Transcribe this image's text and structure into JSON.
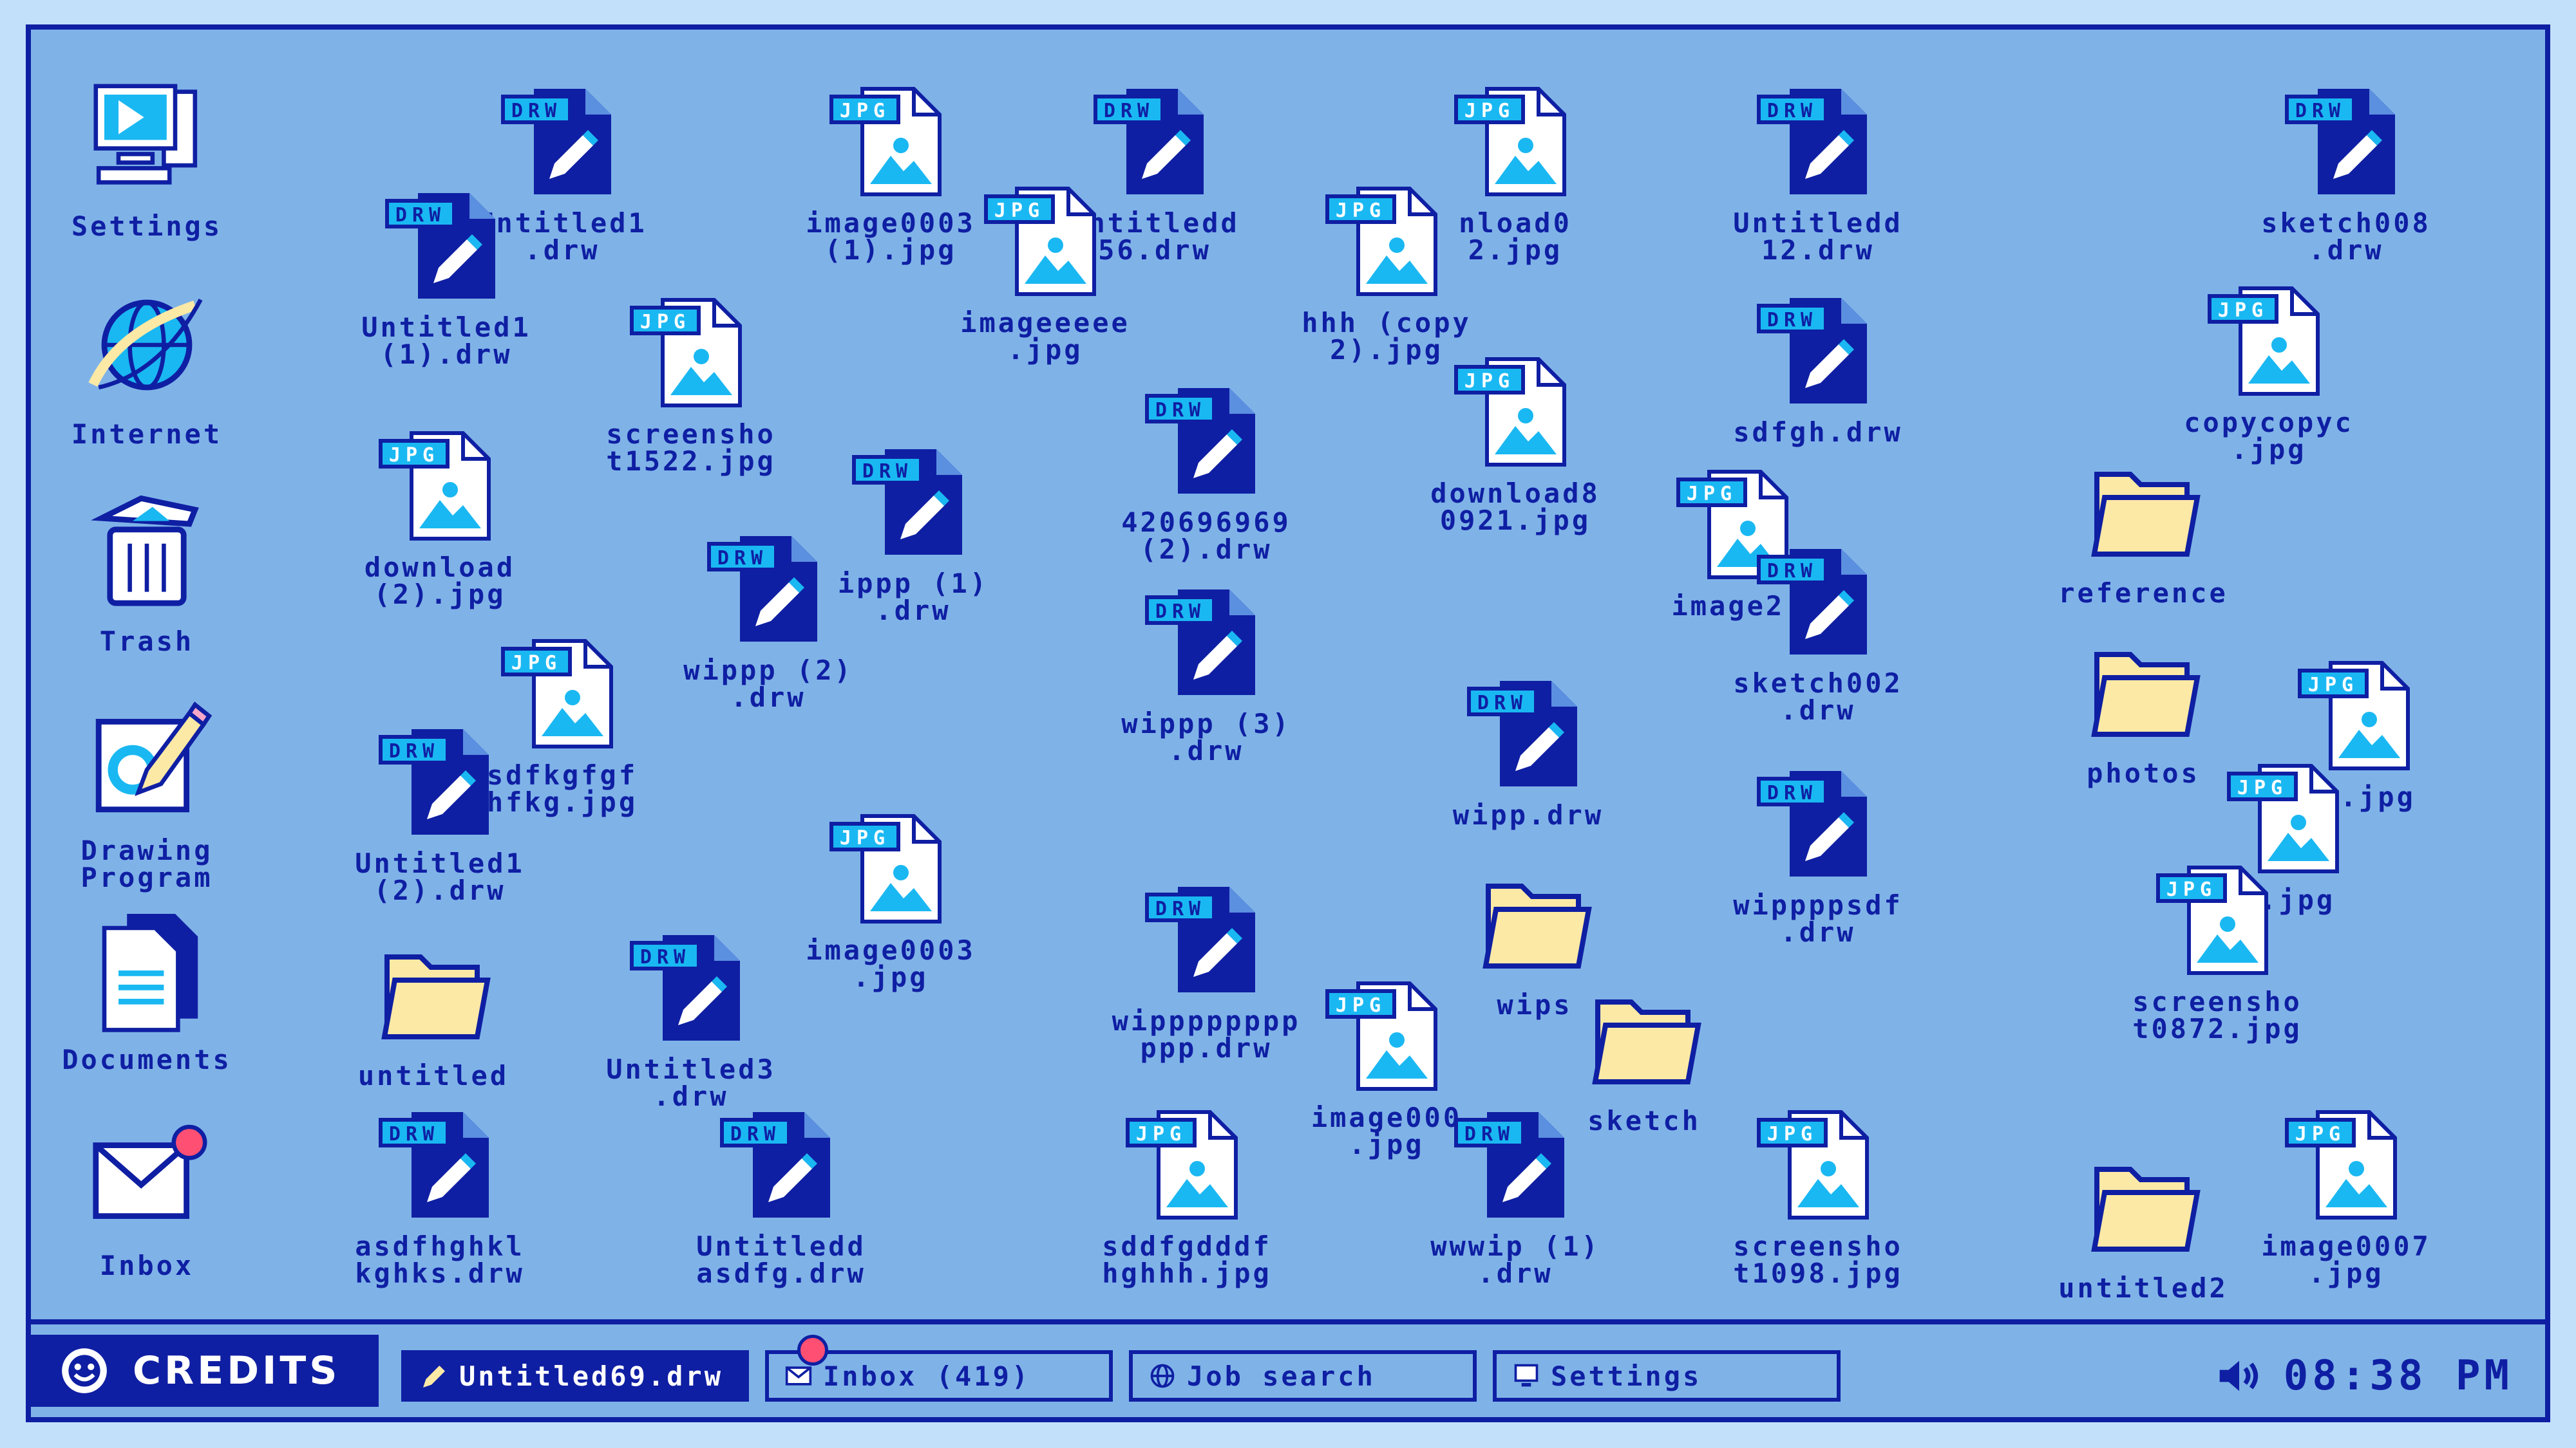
{
  "desktop": {
    "system_icons": [
      {
        "label": "Settings",
        "icon": "settings-computer-icon"
      },
      {
        "label": "Internet",
        "icon": "globe-icon"
      },
      {
        "label": "Trash",
        "icon": "trash-icon"
      },
      {
        "label": "Drawing\nProgram",
        "icon": "drawing-program-icon"
      },
      {
        "label": "Documents",
        "icon": "documents-icon"
      },
      {
        "label": "Inbox",
        "icon": "mail-icon"
      }
    ],
    "files": [
      {
        "label": "Untitled1\n.drw",
        "type": "DRW"
      },
      {
        "label": "Untitled1\n(1).drw",
        "type": "DRW"
      },
      {
        "label": "image0003\n(1).jpg",
        "type": "JPG"
      },
      {
        "label": "Untitledd\n56.drw",
        "type": "DRW"
      },
      {
        "label": "imageeeee\n.jpg",
        "type": "JPG"
      },
      {
        "label": "nload0\n2.jpg",
        "type": "JPG"
      },
      {
        "label": "hhh (copy\n2).jpg",
        "type": "JPG"
      },
      {
        "label": "Untitledd\n12.drw",
        "type": "DRW"
      },
      {
        "label": "sketch008\n.drw",
        "type": "DRW"
      },
      {
        "label": "screensho\nt1522.jpg",
        "type": "JPG"
      },
      {
        "label": "download\n(2).jpg",
        "type": "JPG"
      },
      {
        "label": "ippp (1)\n.drw",
        "type": "DRW"
      },
      {
        "label": "wippp (2)\n.drw",
        "type": "DRW"
      },
      {
        "label": "420696969\n(2).drw",
        "type": "DRW"
      },
      {
        "label": "download8\n0921.jpg",
        "type": "JPG"
      },
      {
        "label": "sdfgh.drw",
        "type": "DRW"
      },
      {
        "label": "copycopyc\n.jpg",
        "type": "JPG"
      },
      {
        "label": "image2.",
        "type": "JPG"
      },
      {
        "label": "sketch002\n.drw",
        "type": "DRW"
      },
      {
        "label": "sdfkgfgf\nhfkg.jpg",
        "type": "JPG"
      },
      {
        "label": "Untitled1\n(2).drw",
        "type": "DRW"
      },
      {
        "label": "wippp (3)\n.drw",
        "type": "DRW"
      },
      {
        "label": "wipp.drw",
        "type": "DRW"
      },
      {
        "label": "wippppsdf\n.drw",
        "type": "DRW"
      },
      {
        "label": "ee.jpg",
        "type": "JPG"
      },
      {
        "label": "e.jpg",
        "type": "JPG"
      },
      {
        "label": "image0003\n.jpg",
        "type": "JPG"
      },
      {
        "label": "wipppppppp\nppp.drw",
        "type": "DRW"
      },
      {
        "label": "screensho\nt0872.jpg",
        "type": "JPG"
      },
      {
        "label": "Untitled3\n.drw",
        "type": "DRW"
      },
      {
        "label": "image000\n.jpg",
        "type": "JPG"
      },
      {
        "label": "asdfhghkl\nkghks.drw",
        "type": "DRW"
      },
      {
        "label": "Untitledd\nasdfg.drw",
        "type": "DRW"
      },
      {
        "label": "sddfgdddf\nhghhh.jpg",
        "type": "JPG"
      },
      {
        "label": "wwwip (1)\n.drw",
        "type": "DRW"
      },
      {
        "label": "screensho\nt1098.jpg",
        "type": "JPG"
      },
      {
        "label": "image0007\n.jpg",
        "type": "JPG"
      }
    ],
    "folders": [
      {
        "label": "reference",
        "icon": "folder-icon"
      },
      {
        "label": "photos",
        "icon": "folder-icon"
      },
      {
        "label": "wips",
        "icon": "folder-icon"
      },
      {
        "label": "sketch",
        "icon": "folder-icon"
      },
      {
        "label": "untitled",
        "icon": "folder-icon"
      },
      {
        "label": "untitled2",
        "icon": "folder-icon"
      }
    ]
  },
  "taskbar": {
    "start_label": "CREDITS",
    "start_icon": "smiley-icon",
    "tasks": [
      {
        "label": "Untitled69.drw",
        "icon": "pencil-icon",
        "active": true
      },
      {
        "label": "Inbox (419)",
        "icon": "mail-icon",
        "active": false
      },
      {
        "label": "Job search",
        "icon": "globe-icon",
        "active": false
      },
      {
        "label": "Settings",
        "icon": "computer-icon",
        "active": false
      }
    ],
    "clock": "08:38 PM",
    "volume_icon": "speaker-icon"
  },
  "colors": {
    "desktop_bg": "#7fb3e8",
    "frame": "#0f1fa3",
    "accent_cyan": "#1ab8f2",
    "folder": "#fde9a6",
    "notification": "#ff4f73"
  }
}
